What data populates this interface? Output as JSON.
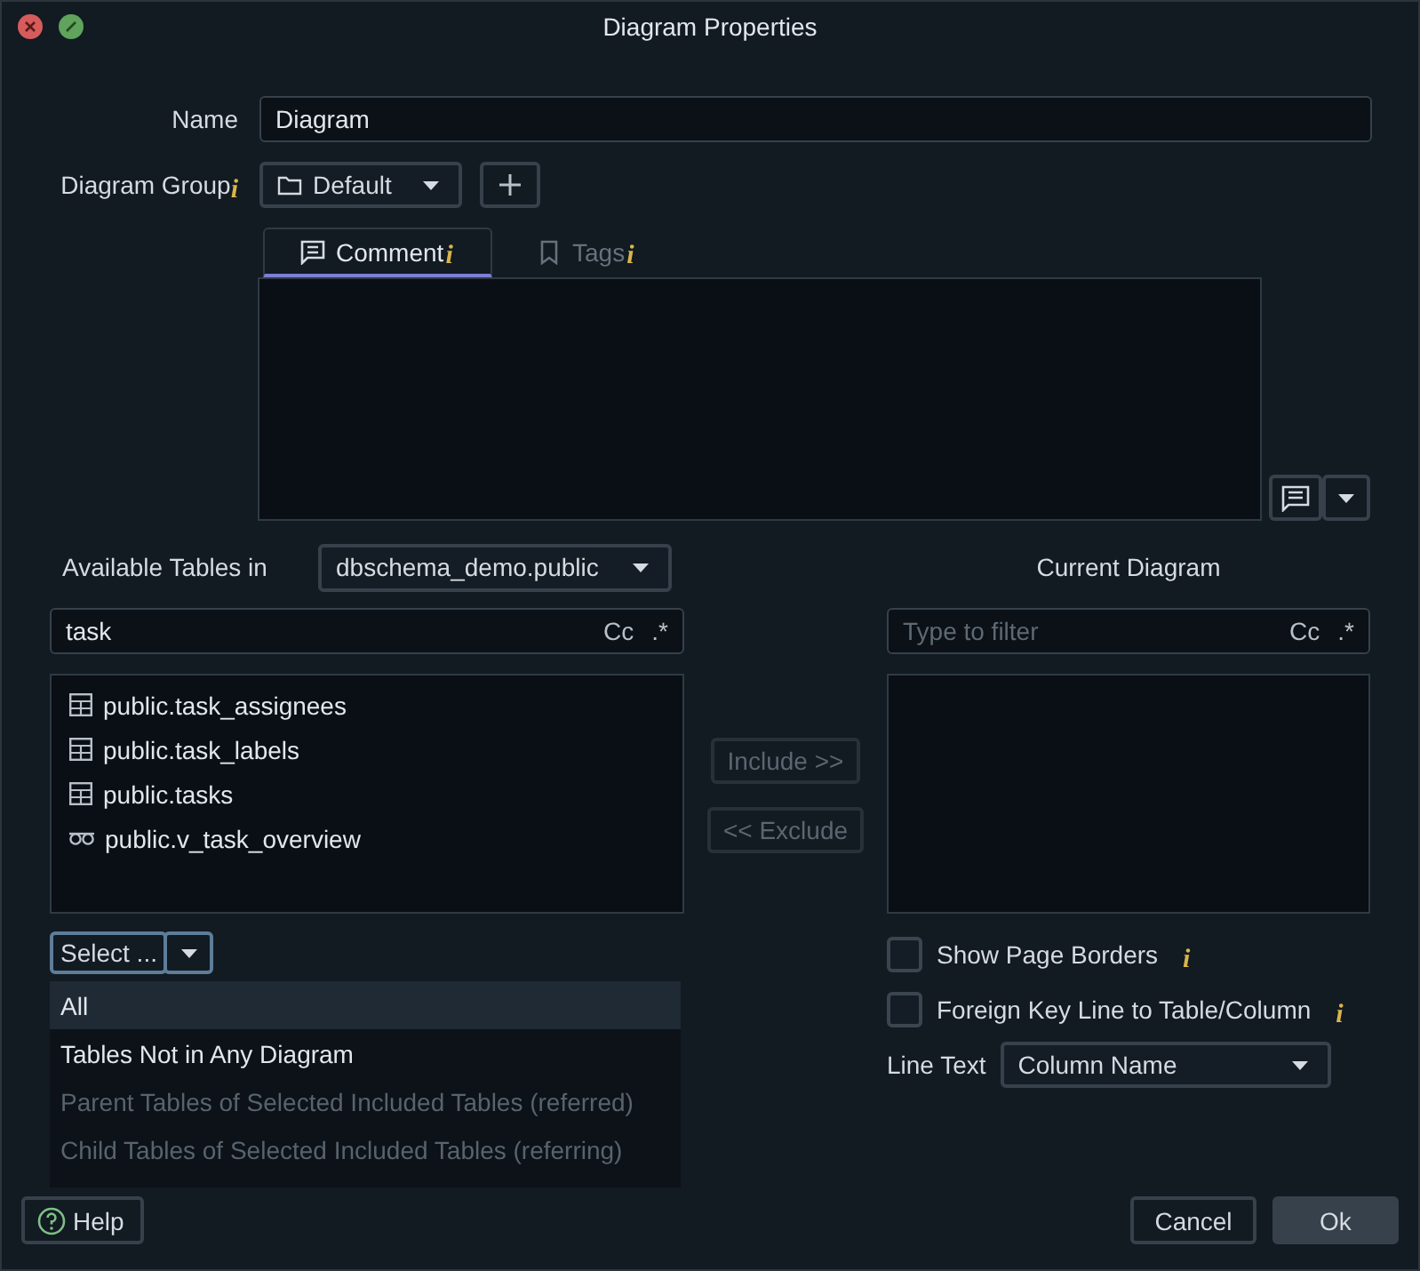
{
  "window": {
    "title": "Diagram Properties"
  },
  "name_field": {
    "label": "Name",
    "value": "Diagram"
  },
  "diagram_group": {
    "label": "Diagram Group",
    "info": "i",
    "value": "Default"
  },
  "tabs": [
    {
      "label": "Comment",
      "info": "i",
      "selected": true
    },
    {
      "label": "Tags",
      "info": "i",
      "selected": false
    }
  ],
  "available": {
    "label": "Available Tables in",
    "schema": "dbschema_demo.public",
    "filter": {
      "value": "task",
      "case_toggle": "Cc",
      "regex_toggle": ".*"
    },
    "items": [
      {
        "kind": "table",
        "name": "public.task_assignees"
      },
      {
        "kind": "table",
        "name": "public.task_labels"
      },
      {
        "kind": "table",
        "name": "public.tasks"
      },
      {
        "kind": "view",
        "name": "public.v_task_overview"
      }
    ]
  },
  "select_menu": {
    "label": "Select ...",
    "expanded": true,
    "options": [
      {
        "label": "All",
        "selected": true,
        "disabled": false
      },
      {
        "label": "Tables Not in Any Diagram",
        "selected": false,
        "disabled": false
      },
      {
        "label": "Parent Tables of Selected Included Tables (referred)",
        "selected": false,
        "disabled": true
      },
      {
        "label": "Child Tables of Selected Included Tables (referring)",
        "selected": false,
        "disabled": true
      }
    ]
  },
  "transfer_buttons": [
    {
      "label": "Include >>",
      "disabled": true
    },
    {
      "label": "<< Exclude",
      "disabled": true
    }
  ],
  "current": {
    "title": "Current Diagram",
    "filter": {
      "placeholder": "Type to filter",
      "case_toggle": "Cc",
      "regex_toggle": ".*"
    }
  },
  "options": [
    {
      "label": "Show Page Borders",
      "info": "i",
      "checked": false
    },
    {
      "label": "Foreign Key Line to Table/Column",
      "info": "i",
      "checked": false
    }
  ],
  "line_text": {
    "label": "Line Text",
    "value": "Column Name"
  },
  "buttons": [
    {
      "kind": "help",
      "label": "Help"
    },
    {
      "kind": "cancel",
      "label": "Cancel"
    },
    {
      "kind": "ok",
      "label": "Ok"
    }
  ]
}
